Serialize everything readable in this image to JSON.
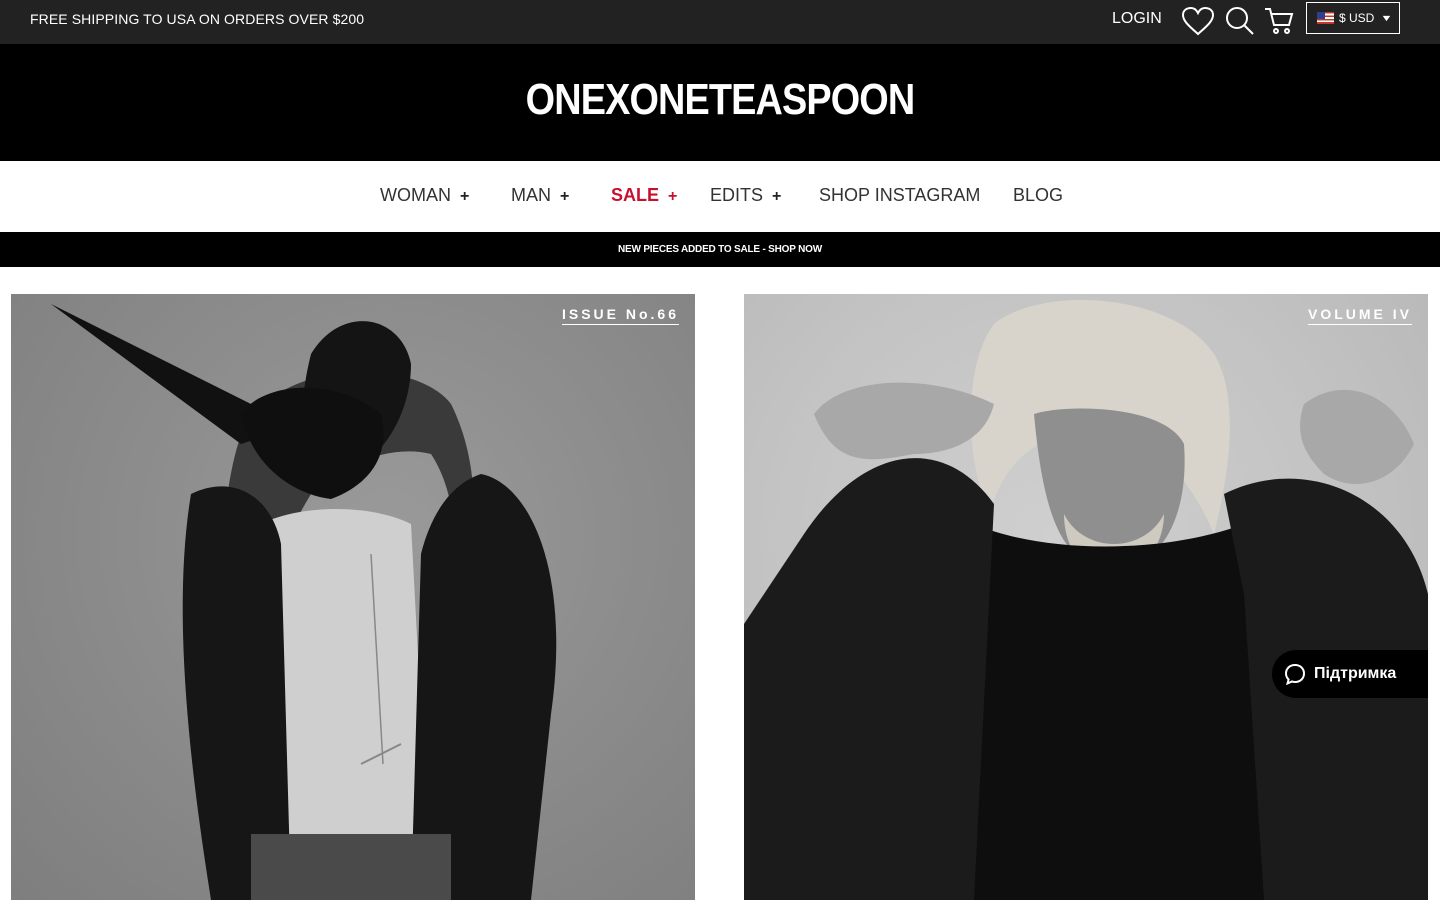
{
  "topbar": {
    "shipping_text": "FREE SHIPPING TO USA ON ORDERS OVER $200",
    "login_label": "LOGIN",
    "currency_label": "$ USD"
  },
  "brand": {
    "logo_text": "ONEXONETEASPOON"
  },
  "nav": {
    "items": [
      {
        "label": "WOMAN",
        "plus": "+"
      },
      {
        "label": "MAN",
        "plus": "+"
      },
      {
        "label": "SALE",
        "plus": "+"
      },
      {
        "label": "EDITS",
        "plus": "+"
      },
      {
        "label": "SHOP INSTAGRAM"
      },
      {
        "label": "BLOG"
      }
    ]
  },
  "announcement": {
    "text": "NEW PIECES ADDED TO SALE - SHOP NOW"
  },
  "tiles": [
    {
      "tag": "ISSUE No.66"
    },
    {
      "tag": "VOLUME IV"
    }
  ],
  "support": {
    "label": "Підтримка"
  },
  "colors": {
    "sale": "#c8102e",
    "topbar_bg": "#222222",
    "logo_bg": "#000000"
  }
}
